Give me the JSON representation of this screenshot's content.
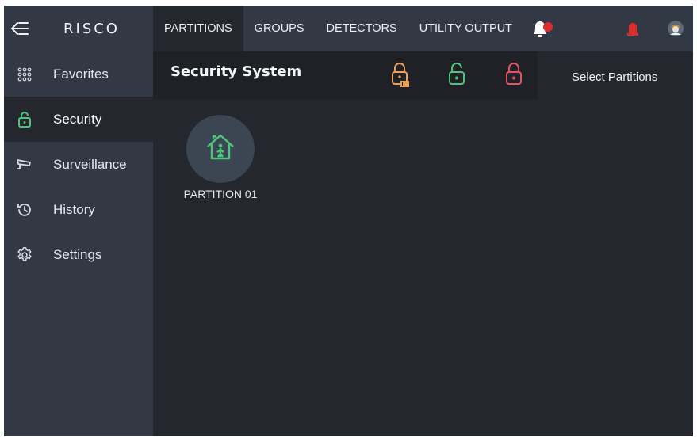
{
  "sidebar": {
    "logo": "RISCO",
    "items": [
      {
        "label": "Favorites",
        "icon": "grid-icon"
      },
      {
        "label": "Security",
        "icon": "lock-icon"
      },
      {
        "label": "Surveillance",
        "icon": "camera-icon"
      },
      {
        "label": "History",
        "icon": "history-icon"
      },
      {
        "label": "Settings",
        "icon": "gear-icon"
      }
    ],
    "active_index": 1
  },
  "topbar": {
    "tabs": [
      "PARTITIONS",
      "GROUPS",
      "DETECTORS",
      "UTILITY OUTPUT"
    ],
    "active_index": 0
  },
  "header": {
    "title": "Security System",
    "select_label": "Select Partitions"
  },
  "partition": {
    "label": "PARTITION 01"
  },
  "colors": {
    "background": "#25272e",
    "panel": "#323945",
    "header": "#1f2127",
    "lock_partial": "#e8a15a",
    "lock_disarm": "#4fc47a",
    "lock_arm": "#e05562",
    "alarm_red": "#e02b2b",
    "house_green": "#4fc47a"
  }
}
